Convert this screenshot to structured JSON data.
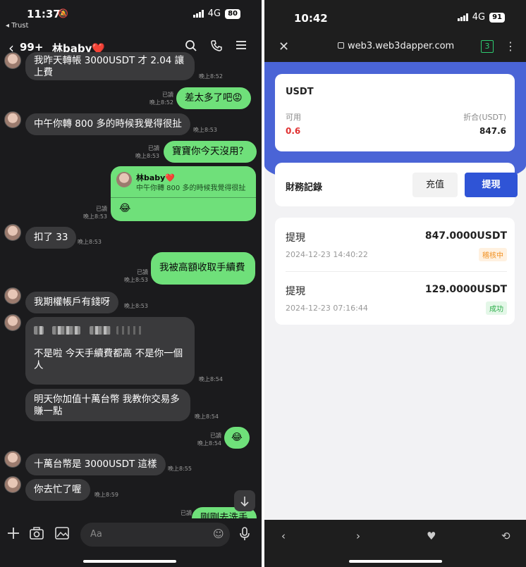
{
  "chat": {
    "status": {
      "time": "11:37",
      "mute_icon": "bell-slash-icon",
      "back_app": "◂ Trust",
      "network": "4G",
      "battery": "80"
    },
    "header": {
      "unread": "99+",
      "name": "林baby❤️",
      "icons": [
        "search-icon",
        "phone-icon",
        "menu-icon"
      ]
    },
    "messages": [
      {
        "dir": "in",
        "text": "我昨天轉帳 3000USDT 才 2.04 讓上費",
        "time": "晚上8:52"
      },
      {
        "dir": "out",
        "text": "差太多了吧😡",
        "read": "已讀",
        "time": "晚上8:52"
      },
      {
        "dir": "in",
        "text": "中午你轉 800 多的時候我覺得很扯",
        "time": "晚上8:53"
      },
      {
        "dir": "out",
        "text": "寶寶你今天沒用？",
        "read": "已讀",
        "time": "晚上8:53"
      },
      {
        "dir": "out-quote",
        "quote_name": "林baby❤️",
        "quote_text": "中午你轉 800 多的時候我覺得很扯",
        "text": "😂",
        "read": "已讀",
        "time": "晚上8:53"
      },
      {
        "dir": "in",
        "text": "扣了 33",
        "time": "晚上8:53"
      },
      {
        "dir": "out",
        "text": "我被高額收取手續費",
        "read": "已讀",
        "time": "晚上8:53"
      },
      {
        "dir": "in",
        "text": "我期權帳戶有錢呀",
        "time": "晚上8:53"
      },
      {
        "dir": "in",
        "text": "不是啦  今天手續費都高 不是你一個人",
        "time": "晚上8:54"
      },
      {
        "dir": "in",
        "text": "明天你加值十萬台幣 我教你交易多賺一點",
        "time": "晚上8:54"
      },
      {
        "dir": "out",
        "text": "😂",
        "read": "已讀",
        "time": "晚上8:54"
      },
      {
        "dir": "in",
        "text": "十萬台幣是 3000USDT 這樣",
        "time": "晚上8:55"
      },
      {
        "dir": "in",
        "text": "你去忙了喔",
        "time": "晚上8:59"
      },
      {
        "dir": "out",
        "text": "剛剛去洗手",
        "read": "已讀",
        "time": ""
      }
    ],
    "input": {
      "placeholder": "Aa",
      "icons": [
        "plus-icon",
        "camera-icon",
        "image-icon",
        "smile-icon",
        "mic-icon"
      ]
    }
  },
  "wallet": {
    "status": {
      "time": "10:42",
      "network": "4G",
      "battery": "91"
    },
    "browser": {
      "url": "web3.web3dapper.com",
      "tab_count": "3"
    },
    "balance": {
      "currency": "USDT",
      "available_label": "可用",
      "value_label": "折合(USDT)",
      "available": "0.6",
      "value": "847.6"
    },
    "records": {
      "title": "財務記錄",
      "deposit_button": "充值",
      "withdraw_button": "提現",
      "items": [
        {
          "type": "提現",
          "amount": "847.0000USDT",
          "datetime": "2024-12-23 14:40:22",
          "status": "稽核中"
        },
        {
          "type": "提現",
          "amount": "129.0000USDT",
          "datetime": "2024-12-23 07:16:44",
          "status": "成功"
        }
      ]
    },
    "nav": [
      "back-icon",
      "forward-icon",
      "heart-icon",
      "refresh-icon"
    ]
  }
}
